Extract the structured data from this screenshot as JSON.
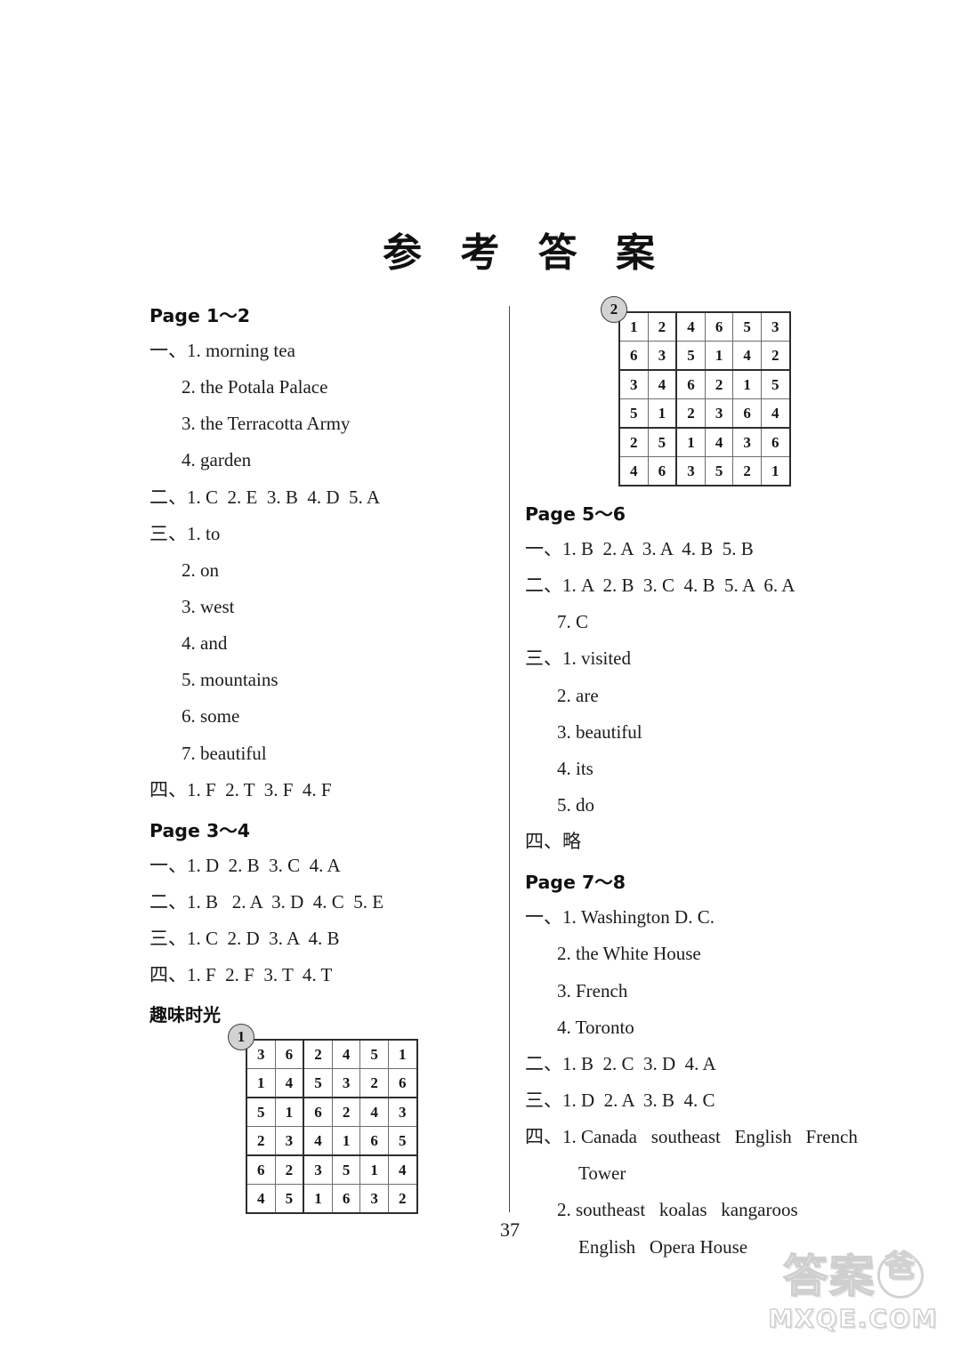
{
  "document": {
    "title": "参 考 答 案",
    "page_number": "37"
  },
  "watermark": {
    "cn_text": "答案",
    "cn_circle_char": "爸",
    "en_text": "MXQE.COM"
  },
  "left_column": {
    "sections": [
      {
        "heading": "Page 1～2",
        "lines": [
          "一、1. morning tea",
          "2. the Potala Palace",
          "3. the Terracotta Army",
          "4. garden",
          "二、1. C  2. E  3. B  4. D  5. A",
          "三、1. to",
          "2. on",
          "3. west",
          "4. and",
          "5. mountains",
          "6. some",
          "7. beautiful",
          "四、1. F  2. T  3. F  4. F"
        ]
      },
      {
        "heading": "Page 3～4",
        "lines": [
          "一、1. D  2. B  3. C  4. A",
          "二、1. B   2. A  3. D  4. C  5. E",
          "三、1. C  2. D  3. A  4. B",
          "四、1. F  2. F  3. T  4. T"
        ]
      }
    ],
    "fun_time_heading": "趣味时光"
  },
  "right_column": {
    "sections": [
      {
        "heading": "Page 5～6",
        "lines": [
          "一、1. B  2. A  3. A  4. B  5. B",
          "二、1. A  2. B  3. C  4. B  5. A  6. A",
          "7. C",
          "三、1. visited",
          "2. are",
          "3. beautiful",
          "4. its",
          "5. do",
          "四、略"
        ]
      },
      {
        "heading": "Page 7～8",
        "lines": [
          "一、1. Washington D. C.",
          "2. the White House",
          "3. French",
          "4. Toronto",
          "二、1. B  2. C  3. D  4. A",
          "三、1. D  2. A  3. B  4. C",
          "四、1. Canada   southeast   English   French",
          "Tower",
          "2. southeast   koalas   kangaroos",
          "English   Opera House"
        ]
      }
    ]
  },
  "puzzles": [
    {
      "badge": "1",
      "rows": [
        [
          3,
          6,
          2,
          4,
          5,
          1
        ],
        [
          1,
          4,
          5,
          3,
          2,
          6
        ],
        [
          5,
          1,
          6,
          2,
          4,
          3
        ],
        [
          2,
          3,
          4,
          1,
          6,
          5
        ],
        [
          6,
          2,
          3,
          5,
          1,
          4
        ],
        [
          4,
          5,
          1,
          6,
          3,
          2
        ]
      ]
    },
    {
      "badge": "2",
      "rows": [
        [
          1,
          2,
          4,
          6,
          5,
          3
        ],
        [
          6,
          3,
          5,
          1,
          4,
          2
        ],
        [
          3,
          4,
          6,
          2,
          1,
          5
        ],
        [
          5,
          1,
          2,
          3,
          6,
          4
        ],
        [
          2,
          5,
          1,
          4,
          3,
          6
        ],
        [
          4,
          6,
          3,
          5,
          2,
          1
        ]
      ]
    }
  ]
}
